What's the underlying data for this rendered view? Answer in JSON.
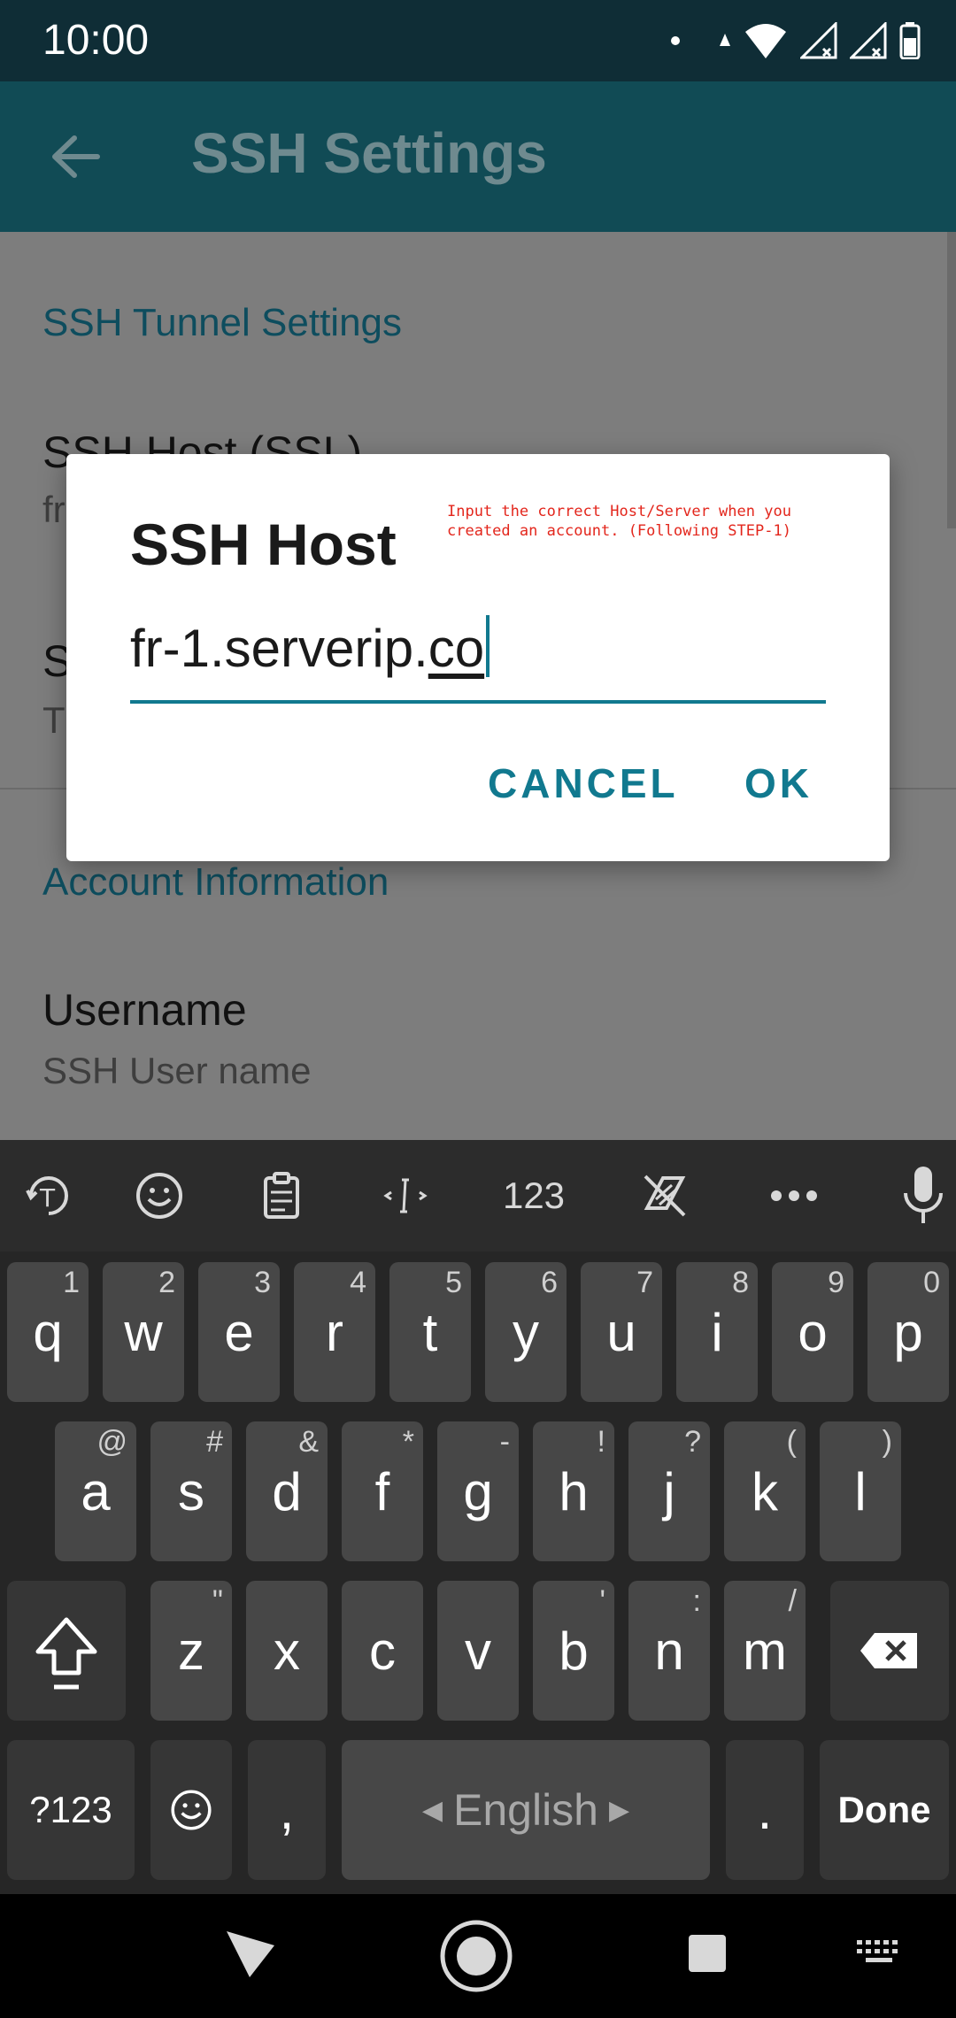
{
  "status_bar": {
    "time": "10:00"
  },
  "app_bar": {
    "title": "SSH Settings"
  },
  "settings": {
    "section_tunnel": "SSH Tunnel Settings",
    "host_title": "SSH Host (SSL)",
    "host_sub": "fr",
    "port_title": "S",
    "port_sub": "T",
    "section_account": "Account Information",
    "username_title": "Username",
    "username_sub": "SSH User name"
  },
  "dialog": {
    "title": "SSH Host",
    "hint": "Input the correct Host/Server when you created an account. (Following STEP-1)",
    "value_plain": "fr-1.serverip.",
    "value_underlined": "co",
    "cancel": "CANCEL",
    "ok": "OK"
  },
  "keyboard": {
    "toolbar": {
      "numbers": "123"
    },
    "row1": [
      {
        "k": "q",
        "h": "1"
      },
      {
        "k": "w",
        "h": "2"
      },
      {
        "k": "e",
        "h": "3"
      },
      {
        "k": "r",
        "h": "4"
      },
      {
        "k": "t",
        "h": "5"
      },
      {
        "k": "y",
        "h": "6"
      },
      {
        "k": "u",
        "h": "7"
      },
      {
        "k": "i",
        "h": "8"
      },
      {
        "k": "o",
        "h": "9"
      },
      {
        "k": "p",
        "h": "0"
      }
    ],
    "row2": [
      {
        "k": "a",
        "h": "@"
      },
      {
        "k": "s",
        "h": "#"
      },
      {
        "k": "d",
        "h": "&"
      },
      {
        "k": "f",
        "h": "*"
      },
      {
        "k": "g",
        "h": "-"
      },
      {
        "k": "h",
        "h": "!"
      },
      {
        "k": "j",
        "h": "?"
      },
      {
        "k": "k",
        "h": "("
      },
      {
        "k": "l",
        "h": ")"
      }
    ],
    "row3": [
      {
        "k": "z",
        "h": "\""
      },
      {
        "k": "x",
        "h": ""
      },
      {
        "k": "c",
        "h": ""
      },
      {
        "k": "v",
        "h": ""
      },
      {
        "k": "b",
        "h": "'"
      },
      {
        "k": "n",
        "h": ":"
      },
      {
        "k": "m",
        "h": "/"
      }
    ],
    "symbols": "?123",
    "comma": ",",
    "space": "English",
    "period": ".",
    "done": "Done"
  },
  "colors": {
    "accent": "#11798f",
    "appbar": "#114b55",
    "hint": "#e3261c"
  }
}
